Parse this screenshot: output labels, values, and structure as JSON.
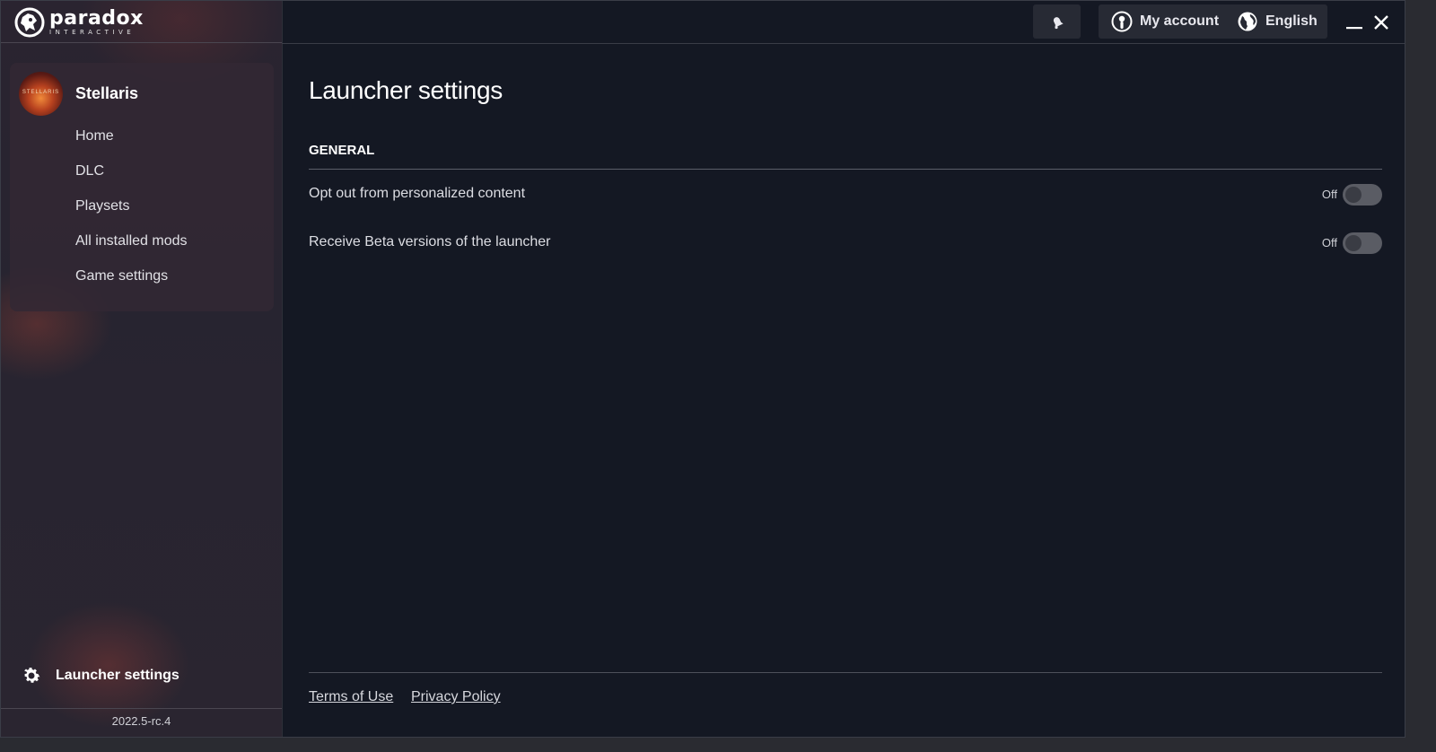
{
  "brand": {
    "name": "paradox",
    "sub": "INTERACTIVE"
  },
  "sidebar": {
    "game_title": "Stellaris",
    "game_avatar_text": "STELLARIS",
    "items": [
      {
        "label": "Home"
      },
      {
        "label": "DLC"
      },
      {
        "label": "Playsets"
      },
      {
        "label": "All installed mods"
      },
      {
        "label": "Game settings"
      }
    ],
    "launcher_settings_label": "Launcher settings",
    "version": "2022.5-rc.4"
  },
  "header": {
    "account_label": "My account",
    "language_label": "English"
  },
  "main": {
    "title": "Launcher settings",
    "section_title": "GENERAL",
    "settings": [
      {
        "label": "Opt out from personalized content",
        "state": "Off"
      },
      {
        "label": "Receive Beta versions of the launcher",
        "state": "Off"
      }
    ],
    "footer_links": [
      "Terms of Use",
      "Privacy Policy"
    ]
  },
  "colors": {
    "background": "#141823",
    "sidebar": "#2a2430",
    "toggle_off": "#5a5c64"
  }
}
